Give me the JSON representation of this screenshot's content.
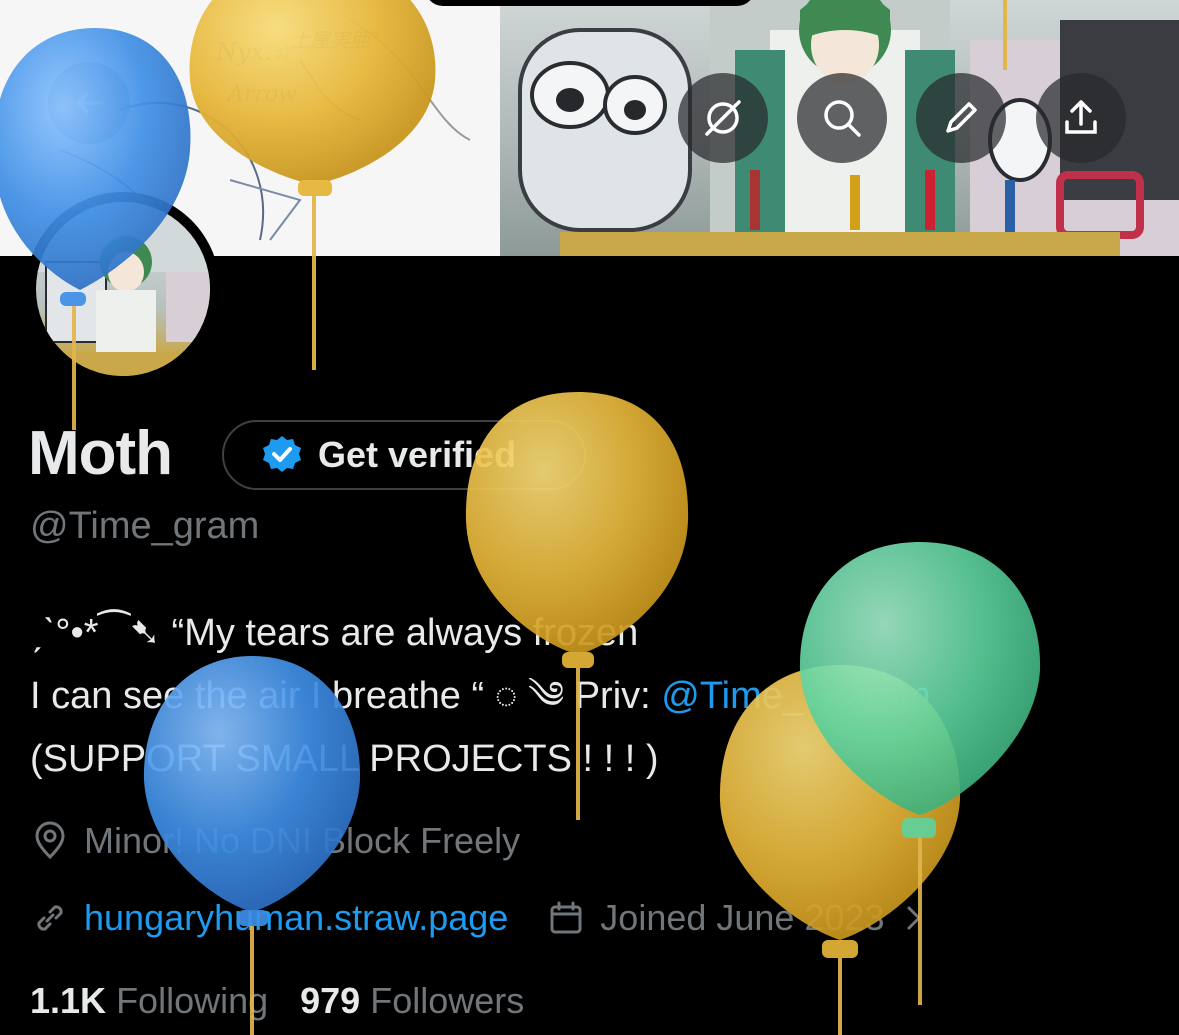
{
  "profile": {
    "display_name": "Moth",
    "verify_label": "Get verified",
    "handle": "@Time_gram",
    "bio_line1": "ˏˋ°•*⁀➷ “My tears are always frozen",
    "bio_line2_prefix": "I can see the air I breathe “ ◌ ༄ Priv: ",
    "bio_line2_link": "@Time_Gramm",
    "bio_line3": "(SUPPORT SMALL PROJECTS ! ! ! )",
    "location": "Minor! No DNI Block Freely",
    "website": "hungaryhuman.straw.page",
    "joined": "Joined June 2023",
    "following_count": "1.1K",
    "following_label": "Following",
    "followers_count": "979",
    "followers_label": "Followers"
  },
  "banner": {
    "sketch_words": [
      "Nyx.☆",
      "Arrow",
      "土屋実亜°"
    ]
  },
  "icons": {
    "back": "arrow-left-icon",
    "circle_hide": "eye-slash-icon",
    "search": "search-icon",
    "edit": "pencil-icon",
    "share": "share-icon",
    "verified": "verified-badge-icon",
    "location": "location-pin-icon",
    "link": "link-icon",
    "calendar": "calendar-icon",
    "chevron": "chevron-right-icon"
  },
  "colors": {
    "background": "#000000",
    "text_primary": "#e7e9ea",
    "text_secondary": "#71767b",
    "link": "#1d9bf0",
    "balloon_blue": "#4a90e2",
    "balloon_yellow": "#e8b83a",
    "balloon_green": "#5fd3a0"
  }
}
